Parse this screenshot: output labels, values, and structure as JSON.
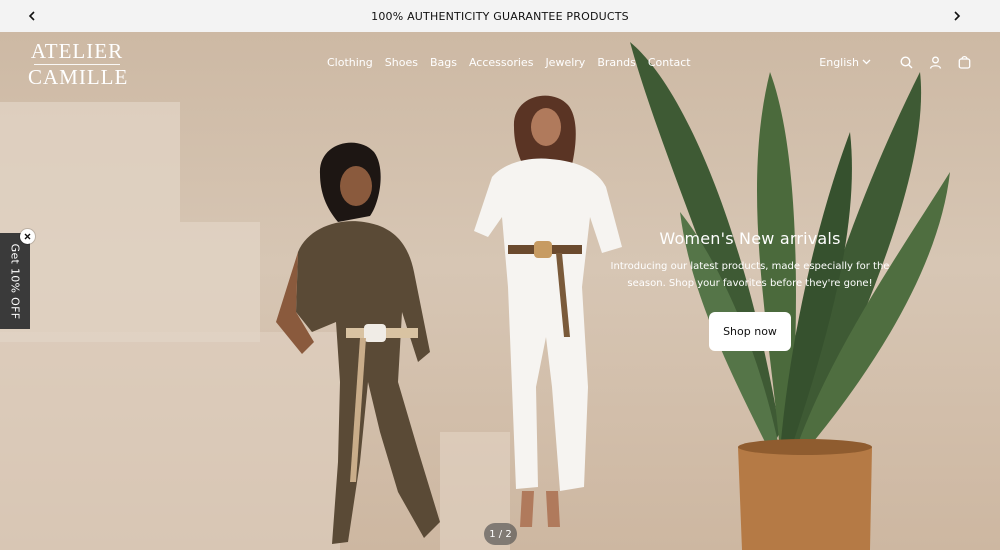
{
  "announcement": {
    "text": "100% AUTHENTICITY GUARANTEE PRODUCTS",
    "prev_icon": "chevron-left-icon",
    "next_icon": "chevron-right-icon"
  },
  "brand": {
    "line1": "ATELIER",
    "line2": "CAMILLE"
  },
  "nav": {
    "items": [
      "Clothing",
      "Shoes",
      "Bags",
      "Accessories",
      "Jewelry",
      "Brands",
      "Contact"
    ]
  },
  "utilities": {
    "language": "English",
    "icons": [
      "search-icon",
      "account-icon",
      "cart-icon"
    ]
  },
  "hero": {
    "title": "Women's New arrivals",
    "subtitle": "Introducing our latest products, made especially for the season. Shop your favorites before they're gone!",
    "cta": "Shop now",
    "slide_counter": "1 / 2"
  },
  "side_tab": {
    "label": "Get 10% OFF"
  },
  "colors": {
    "announcement_bg": "#f3f3f3",
    "hero_tone": "#d3c1ad",
    "tab_bg": "#3a3a3a"
  }
}
